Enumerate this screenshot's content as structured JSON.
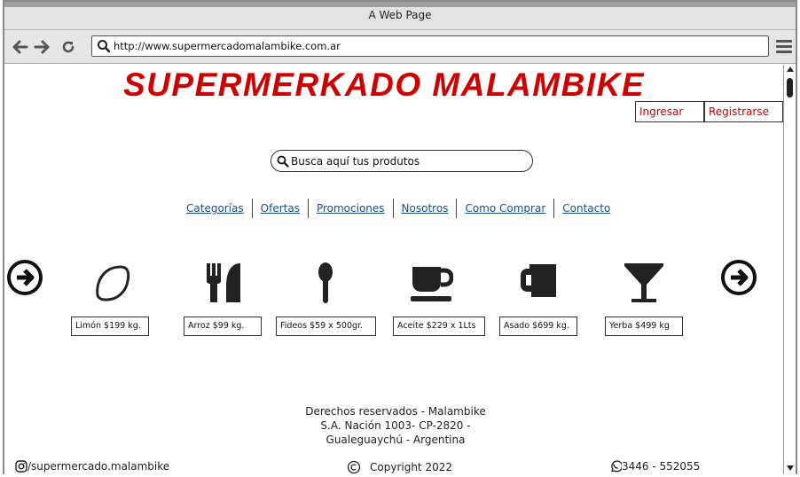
{
  "window": {
    "title": "A Web Page"
  },
  "browser": {
    "url": "http://www.supermercadomalambike.com.ar"
  },
  "site": {
    "brand": "SUPERMERKADO MALAMBIKE",
    "brand_color": "#cc0000",
    "login_label": "Ingresar",
    "register_label": "Registrarse"
  },
  "search": {
    "placeholder": "Busca aquí tus produtos"
  },
  "nav": {
    "items": [
      "Categorías",
      "Ofertas",
      "Promociones",
      "Nosotros",
      "Como Comprar",
      "Contacto"
    ],
    "link_color": "#1a4d8c"
  },
  "carousel": {
    "prev_icon": "arrow-circle-left-icon",
    "next_icon": "arrow-circle-right-icon",
    "products": [
      {
        "icon": "lemon-icon",
        "label": "Limón $199 kg."
      },
      {
        "icon": "fork-knife-icon",
        "label": "Arroz $99 kg."
      },
      {
        "icon": "spoon-icon",
        "label": "Fideos $59 x 500gr."
      },
      {
        "icon": "coffee-cup-icon",
        "label": "Aceite $229 x 1Lts"
      },
      {
        "icon": "beer-mug-icon",
        "label": "Asado $699 kg."
      },
      {
        "icon": "cocktail-glass-icon",
        "label": "Yerba $499 kg"
      }
    ]
  },
  "footer": {
    "rights_line1": "Derechos reservados - Malambike",
    "rights_line2": "S.A. Nación 1003- CP-2820 -",
    "rights_line3": "Gualeguaychú - Argentina",
    "instagram": "/supermercado.malambike",
    "copyright": "Copyright 2022",
    "phone": "3446 - 552055"
  }
}
